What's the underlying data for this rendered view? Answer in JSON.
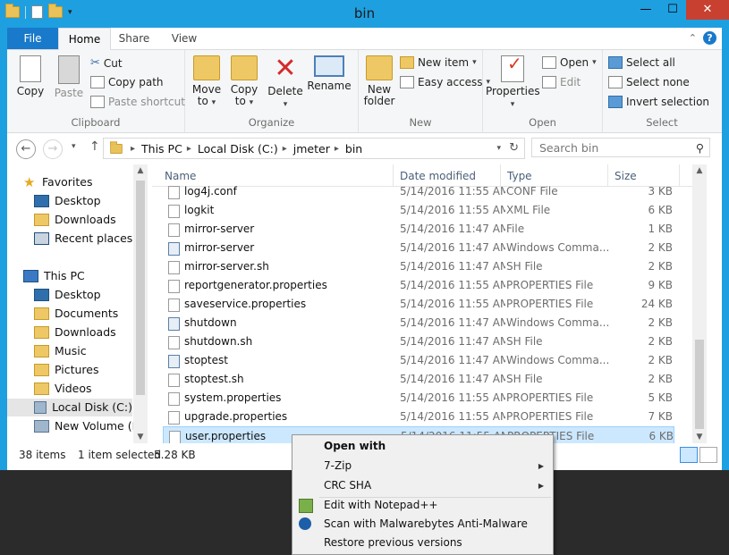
{
  "window": {
    "title": "bin",
    "controls": {
      "minimize": "—",
      "maximize": "☐",
      "close": "✕"
    }
  },
  "ribbon_tabs": [
    {
      "label": "File"
    },
    {
      "label": "Home"
    },
    {
      "label": "Share"
    },
    {
      "label": "View"
    }
  ],
  "ribbon": {
    "clipboard": {
      "label": "Clipboard",
      "copy": "Copy",
      "paste": "Paste",
      "cut": "Cut",
      "copy_path": "Copy path",
      "paste_shortcut": "Paste shortcut"
    },
    "organize": {
      "label": "Organize",
      "move_to_1": "Move",
      "move_to_2": "to",
      "copy_to_1": "Copy",
      "copy_to_2": "to",
      "delete": "Delete",
      "rename": "Rename"
    },
    "new": {
      "label": "New",
      "new_folder_1": "New",
      "new_folder_2": "folder",
      "new_item": "New item",
      "easy_access": "Easy access"
    },
    "open": {
      "label": "Open",
      "properties": "Properties",
      "open": "Open",
      "edit": "Edit"
    },
    "select": {
      "label": "Select",
      "select_all": "Select all",
      "select_none": "Select none",
      "invert_selection": "Invert selection"
    }
  },
  "address": {
    "crumbs": [
      "This PC",
      "Local Disk (C:)",
      "jmeter",
      "bin"
    ],
    "search_placeholder": "Search bin"
  },
  "nav": {
    "favorites": "Favorites",
    "desktop": "Desktop",
    "downloads": "Downloads",
    "recent": "Recent places",
    "this_pc": "This PC",
    "pc_desktop": "Desktop",
    "documents": "Documents",
    "pc_downloads": "Downloads",
    "music": "Music",
    "pictures": "Pictures",
    "videos": "Videos",
    "local_disk": "Local Disk (C:)",
    "new_volume": "New Volume (D:)"
  },
  "columns": {
    "name": "Name",
    "date": "Date modified",
    "type": "Type",
    "size": "Size"
  },
  "files": [
    {
      "name": "log4j.conf",
      "date": "5/14/2016 11:55 AM",
      "type": "CONF File",
      "size": "3 KB",
      "icon": "doc"
    },
    {
      "name": "logkit",
      "date": "5/14/2016 11:55 AM",
      "type": "XML File",
      "size": "6 KB",
      "icon": "doc"
    },
    {
      "name": "mirror-server",
      "date": "5/14/2016 11:47 AM",
      "type": "File",
      "size": "1 KB",
      "icon": "doc"
    },
    {
      "name": "mirror-server",
      "date": "5/14/2016 11:47 AM",
      "type": "Windows Comma...",
      "size": "2 KB",
      "icon": "gear"
    },
    {
      "name": "mirror-server.sh",
      "date": "5/14/2016 11:47 AM",
      "type": "SH File",
      "size": "2 KB",
      "icon": "doc"
    },
    {
      "name": "reportgenerator.properties",
      "date": "5/14/2016 11:55 AM",
      "type": "PROPERTIES File",
      "size": "9 KB",
      "icon": "doc"
    },
    {
      "name": "saveservice.properties",
      "date": "5/14/2016 11:55 AM",
      "type": "PROPERTIES File",
      "size": "24 KB",
      "icon": "doc"
    },
    {
      "name": "shutdown",
      "date": "5/14/2016 11:47 AM",
      "type": "Windows Comma...",
      "size": "2 KB",
      "icon": "gear"
    },
    {
      "name": "shutdown.sh",
      "date": "5/14/2016 11:47 AM",
      "type": "SH File",
      "size": "2 KB",
      "icon": "doc"
    },
    {
      "name": "stoptest",
      "date": "5/14/2016 11:47 AM",
      "type": "Windows Comma...",
      "size": "2 KB",
      "icon": "gear"
    },
    {
      "name": "stoptest.sh",
      "date": "5/14/2016 11:47 AM",
      "type": "SH File",
      "size": "2 KB",
      "icon": "doc"
    },
    {
      "name": "system.properties",
      "date": "5/14/2016 11:55 AM",
      "type": "PROPERTIES File",
      "size": "5 KB",
      "icon": "doc"
    },
    {
      "name": "upgrade.properties",
      "date": "5/14/2016 11:55 AM",
      "type": "PROPERTIES File",
      "size": "7 KB",
      "icon": "doc"
    },
    {
      "name": "user.properties",
      "date": "5/14/2016 11:55 AM",
      "type": "PROPERTIES File",
      "size": "6 KB",
      "icon": "doc"
    }
  ],
  "status": {
    "count": "38 items",
    "selected": "1 item selected",
    "size": "5.28 KB"
  },
  "context_menu": {
    "open_with": "Open with",
    "seven_zip": "7-Zip",
    "crc_sha": "CRC SHA",
    "edit_notepad": "Edit with Notepad++",
    "malwarebytes": "Scan with Malwarebytes Anti-Malware",
    "restore": "Restore previous versions"
  },
  "colors": {
    "accent": "#1e9fe0",
    "file_tab": "#1979ca",
    "selection": "#cce8ff"
  }
}
